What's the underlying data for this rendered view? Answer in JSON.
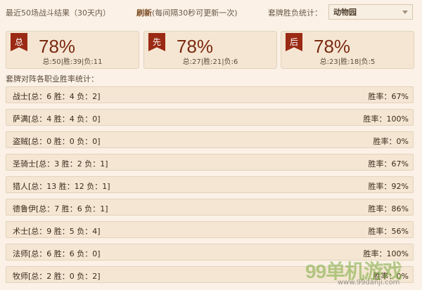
{
  "header": {
    "recent_label": "最近50场战斗结果（30天内）",
    "refresh_link": "刷新",
    "refresh_note": "(每间隔30秒可更新一次)",
    "deck_label": "套牌胜负统计：",
    "deck_selected": "动物园"
  },
  "stats": [
    {
      "badge": "总",
      "percent": "78%",
      "detail": "总:50|胜:39|负:11"
    },
    {
      "badge": "先",
      "percent": "78%",
      "detail": "总:27|胜:21|负:6"
    },
    {
      "badge": "后",
      "percent": "78%",
      "detail": "总:23|胜:18|负:5"
    }
  ],
  "section_title": "套牌对阵各职业胜率统计：",
  "classes": [
    {
      "name": "战士[总：6 胜：4 负：2]",
      "rate": "胜率：67%"
    },
    {
      "name": "萨满[总：4 胜：4 负：0]",
      "rate": "胜率：100%"
    },
    {
      "name": "盗贼[总：0 胜：0 负：0]",
      "rate": "胜率：0%"
    },
    {
      "name": "圣骑士[总：3 胜：2 负：1]",
      "rate": "胜率：67%"
    },
    {
      "name": "猎人[总：13 胜：12 负：1]",
      "rate": "胜率：92%"
    },
    {
      "name": "德鲁伊[总：7 胜：6 负：1]",
      "rate": "胜率：86%"
    },
    {
      "name": "术士[总：9 胜：5 负：4]",
      "rate": "胜率：56%"
    },
    {
      "name": "法师[总：6 胜：6 负：0]",
      "rate": "胜率：100%"
    },
    {
      "name": "牧师[总：2 胜：0 负：2]",
      "rate": "胜率：0%"
    }
  ],
  "watermark": {
    "mark": "99单机游戏",
    "site": "www.99danji.com"
  },
  "colors": {
    "accent": "#7a2a10",
    "badge": "#9a2a14",
    "panel": "#f5e6d3",
    "background": "#fbf1e6"
  }
}
